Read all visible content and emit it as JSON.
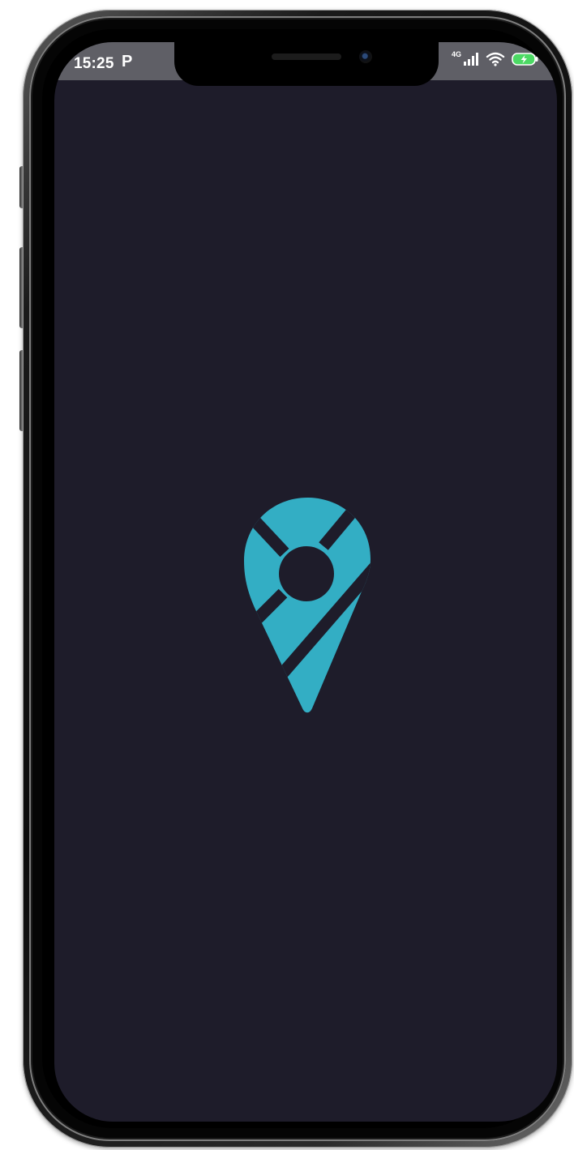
{
  "status_bar": {
    "time": "15:25",
    "app_notification": "P",
    "network": "4G",
    "icons": [
      "signal-icon",
      "wifi-icon",
      "battery-charging-icon"
    ]
  },
  "splash": {
    "logo_icon": "location-pin-logo-icon",
    "logo_color": "#33aec4",
    "background_color": "#1e1c2a"
  }
}
